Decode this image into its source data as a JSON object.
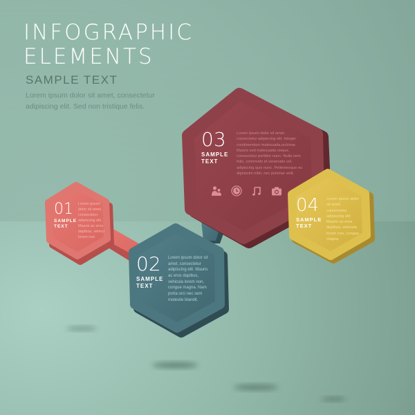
{
  "header": {
    "title_line1": "INFOGRAPHIC",
    "title_line2": "ELEMENTS",
    "subtitle": "SAMPLE TEXT",
    "intro_line1": "Lorem ipsum dolor sit amet, consectetur",
    "intro_line2": "adipiscing elit. Sed non tristique felis."
  },
  "colors": {
    "hex01": "#e0706a",
    "hex02": "#4a7078",
    "hex03": "#8e3f46",
    "hex04": "#dcbd4d"
  },
  "steps": [
    {
      "number": "01",
      "label_line1": "SAMPLE",
      "label_line2": "TEXT",
      "body": "Lorem ipsum dolor sit amet, consectetur adipiscing elit. Mauris ac eros dapibus, vehicu lorem non"
    },
    {
      "number": "02",
      "label_line1": "SAMPLE",
      "label_line2": "TEXT",
      "body": "Lorem ipsum dolor sit amet, consectetur adipiscing elit. Mauris ac eros dapibus, vehicula lorem non, congue magna. Nam porta orci nec sem molestie blandit."
    },
    {
      "number": "03",
      "label_line1": "SAMPLE",
      "label_line2": "TEXT",
      "body": "Lorem ipsum dolor sit amet, consectetur adipiscing elit. Integer condimentum malesuada pulvinar. Mauris sed malesuada neque, consectetur porttitor nunc. Nulla sem felis, commodo id venenatis vel, adipiscing quis nunc. Pellentesque eu dignissim nibh, nec pulvinar velit.",
      "icons": [
        "people-icon",
        "clock-icon",
        "music-note-icon",
        "camera-icon"
      ]
    },
    {
      "number": "04",
      "label_line1": "SAMPLE",
      "label_line2": "TEXT",
      "body": "Lorem ipsum dolor sit amet, consectetur adipiscing elit. Mauris ac eros dapibus, vehicula lorem non, congue magna"
    }
  ]
}
